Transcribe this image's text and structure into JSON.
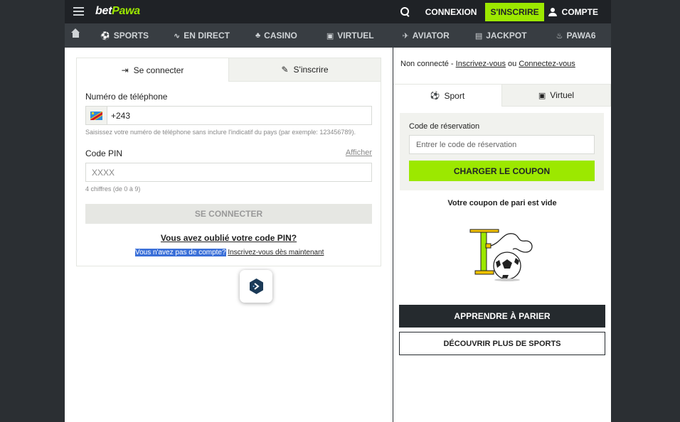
{
  "header": {
    "logo_bet": "bet",
    "logo_pawa": "Pawa",
    "login_label": "CONNEXION",
    "signup_label": "S'INSCRIRE",
    "account_label": "COMPTE"
  },
  "nav": {
    "items": [
      {
        "label": "SPORTS",
        "icon": "soccer-ball-icon",
        "glyph": "⚽"
      },
      {
        "label": "EN DIRECT",
        "icon": "pulse-icon",
        "glyph": "∿"
      },
      {
        "label": "CASINO",
        "icon": "cherries-icon",
        "glyph": "♣"
      },
      {
        "label": "VIRTUEL",
        "icon": "monitor-icon",
        "glyph": "▣"
      },
      {
        "label": "AVIATOR",
        "icon": "plane-icon",
        "glyph": "✈"
      },
      {
        "label": "JACKPOT",
        "icon": "ticket-icon",
        "glyph": "▤"
      },
      {
        "label": "PAWA6",
        "icon": "flame-icon",
        "glyph": "♨"
      }
    ]
  },
  "login": {
    "tab_login": "Se connecter",
    "tab_register": "S'inscrire",
    "phone_label": "Numéro de téléphone",
    "phone_prefix": "+243",
    "phone_hint": "Saisissez votre numéro de téléphone sans inclure l'indicatif du pays (par exemple: 123456789).",
    "pin_label": "Code PIN",
    "show_label": "Afficher",
    "pin_placeholder": "XXXX",
    "pin_hint": "4 chiffres (de 0 à 9)",
    "submit_label": "SE CONNECTER",
    "forgot_label": "Vous avez oublié votre code PIN?",
    "no_account_label": "Vous n'avez pas de compte?",
    "register_now_label": "Inscrivez-vous dès maintenant"
  },
  "betslip": {
    "status_prefix": "Non connecté - ",
    "register_link": "Inscrivez-vous",
    "status_or": " ou ",
    "login_link": "Connectez-vous",
    "tab_sport": "Sport",
    "tab_virtual": "Virtuel",
    "booking_label": "Code de réservation",
    "booking_placeholder": "Entrer le code de réservation",
    "load_coupon_label": "CHARGER LE COUPON",
    "empty_title": "Votre coupon de pari est vide",
    "learn_label": "APPRENDRE À PARIER",
    "discover_label": "DÉCOUVRIR PLUS DE SPORTS"
  },
  "colors": {
    "brand_green": "#9ce800",
    "header_bg": "#1f2226",
    "nav_bg": "#383d42",
    "dark_button": "#252a2e"
  }
}
